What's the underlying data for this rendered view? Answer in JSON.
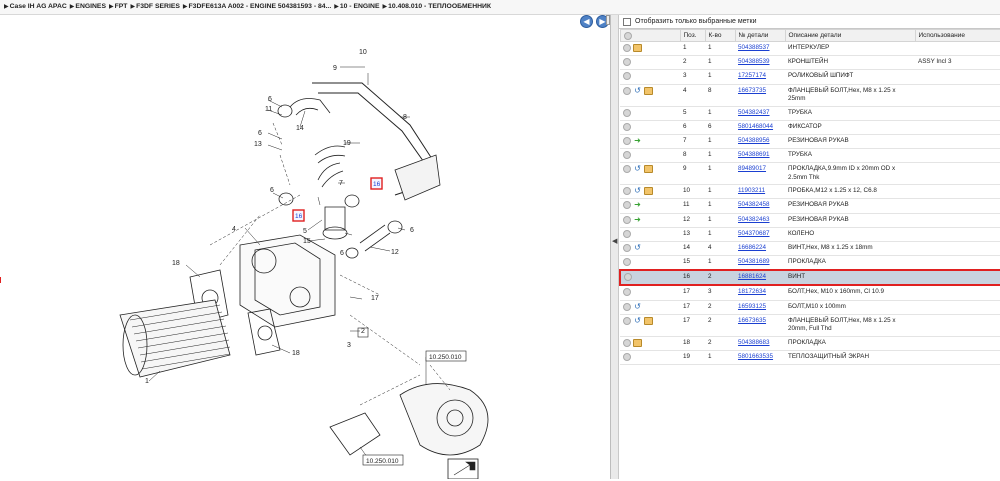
{
  "breadcrumb": [
    "Case IH AG APAC",
    "ENGINES",
    "FPT",
    "F3DF SERIES",
    "F3DFE613A A002 - ENGINE 504381593 - 84...",
    "10 - ENGINE",
    "10.408.010 - ТЕПЛООБМЕННИК"
  ],
  "filter_label": "Отобразить только выбранные метки",
  "columns": {
    "pos": "Поз.",
    "qty": "К-во",
    "num": "№ детали",
    "desc": "Описание детали",
    "use": "Использование"
  },
  "rows": [
    {
      "pos": "1",
      "qty": "1",
      "num": "504388537",
      "desc": "ИНТЕРКУЛЕР",
      "use": "",
      "icons": [
        "dot",
        "box"
      ]
    },
    {
      "pos": "2",
      "qty": "1",
      "num": "504388539",
      "desc": "КРОНШТЕЙН",
      "use": "ASSY Incl 3",
      "icons": [
        "dot"
      ]
    },
    {
      "pos": "3",
      "qty": "1",
      "num": "17257174",
      "desc": "РОЛИКОВЫЙ ШПИФТ",
      "use": "",
      "icons": [
        "dot"
      ]
    },
    {
      "pos": "4",
      "qty": "8",
      "num": "16673735",
      "desc": "ФЛАНЦЕВЫЙ БОЛТ,Hex, M8 x 1.25 x 25mm",
      "use": "",
      "icons": [
        "dot",
        "swap",
        "box"
      ]
    },
    {
      "pos": "5",
      "qty": "1",
      "num": "504382437",
      "desc": "ТРУБКА",
      "use": "",
      "icons": [
        "dot"
      ]
    },
    {
      "pos": "6",
      "qty": "6",
      "num": "5801468044",
      "desc": "ФИКСАТОР",
      "use": "",
      "icons": [
        "dot"
      ]
    },
    {
      "pos": "7",
      "qty": "1",
      "num": "504388956",
      "desc": "РЕЗИНОВАЯ РУКАВ",
      "use": "",
      "icons": [
        "dot",
        "go"
      ]
    },
    {
      "pos": "8",
      "qty": "1",
      "num": "504388691",
      "desc": "ТРУБКА",
      "use": "",
      "icons": [
        "dot"
      ]
    },
    {
      "pos": "9",
      "qty": "1",
      "num": "89489017",
      "desc": "ПРОКЛАДКА,9.9mm ID x 20mm OD x 2.5mm Thk",
      "use": "",
      "icons": [
        "dot",
        "swap",
        "box"
      ]
    },
    {
      "pos": "10",
      "qty": "1",
      "num": "11903211",
      "desc": "ПРОБКА,M12 x 1.25 x 12, C6.8",
      "use": "",
      "icons": [
        "dot",
        "swap",
        "box"
      ]
    },
    {
      "pos": "11",
      "qty": "1",
      "num": "504382458",
      "desc": "РЕЗИНОВАЯ РУКАВ",
      "use": "",
      "icons": [
        "dot",
        "go"
      ]
    },
    {
      "pos": "12",
      "qty": "1",
      "num": "504382463",
      "desc": "РЕЗИНОВАЯ РУКАВ",
      "use": "",
      "icons": [
        "dot",
        "go"
      ]
    },
    {
      "pos": "13",
      "qty": "1",
      "num": "504370687",
      "desc": "КОЛЕНО",
      "use": "",
      "icons": [
        "dot"
      ]
    },
    {
      "pos": "14",
      "qty": "4",
      "num": "16686224",
      "desc": "ВИНТ,Hex, M8 x 1.25 x 18mm",
      "use": "",
      "icons": [
        "dot",
        "swap"
      ]
    },
    {
      "pos": "15",
      "qty": "1",
      "num": "504381689",
      "desc": "ПРОКЛАДКА",
      "use": "",
      "icons": [
        "dot"
      ]
    },
    {
      "pos": "16",
      "qty": "2",
      "num": "16881624",
      "desc": "ВИНТ",
      "use": "",
      "icons": [
        "dot"
      ],
      "selected": true
    },
    {
      "pos": "17",
      "qty": "3",
      "num": "18172634",
      "desc": "БОЛТ,Hex, M10 x 160mm, Cl 10.9",
      "use": "",
      "icons": [
        "dot"
      ]
    },
    {
      "pos": "17",
      "qty": "2",
      "num": "16593125",
      "desc": "БОЛТ,M10 x 100mm",
      "use": "",
      "icons": [
        "dot",
        "swap"
      ]
    },
    {
      "pos": "17",
      "qty": "2",
      "num": "16673635",
      "desc": "ФЛАНЦЕВЫЙ БОЛТ,Hex, M8 x 1.25 x 20mm, Full Thd",
      "use": "",
      "icons": [
        "dot",
        "swap",
        "box"
      ]
    },
    {
      "pos": "18",
      "qty": "2",
      "num": "504388683",
      "desc": "ПРОКЛАДКА",
      "use": "",
      "icons": [
        "dot",
        "box"
      ]
    },
    {
      "pos": "19",
      "qty": "1",
      "num": "5801663535",
      "desc": "ТЕПЛОЗАЩИТНЫЙ ЭКРАН",
      "use": "",
      "icons": [
        "dot"
      ]
    }
  ],
  "diagram": {
    "callouts": [
      "1",
      "2",
      "3",
      "4",
      "5",
      "6",
      "6",
      "6",
      "6",
      "7",
      "8",
      "9",
      "10",
      "11",
      "12",
      "13",
      "14",
      "15",
      "16",
      "16",
      "17",
      "18",
      "18",
      "19"
    ],
    "refs": [
      "10.250.010",
      "10.250.010"
    ]
  },
  "colors": {
    "highlight": "#e02020",
    "link": "#1a3fd1",
    "selected_row": "#c8d3df"
  }
}
